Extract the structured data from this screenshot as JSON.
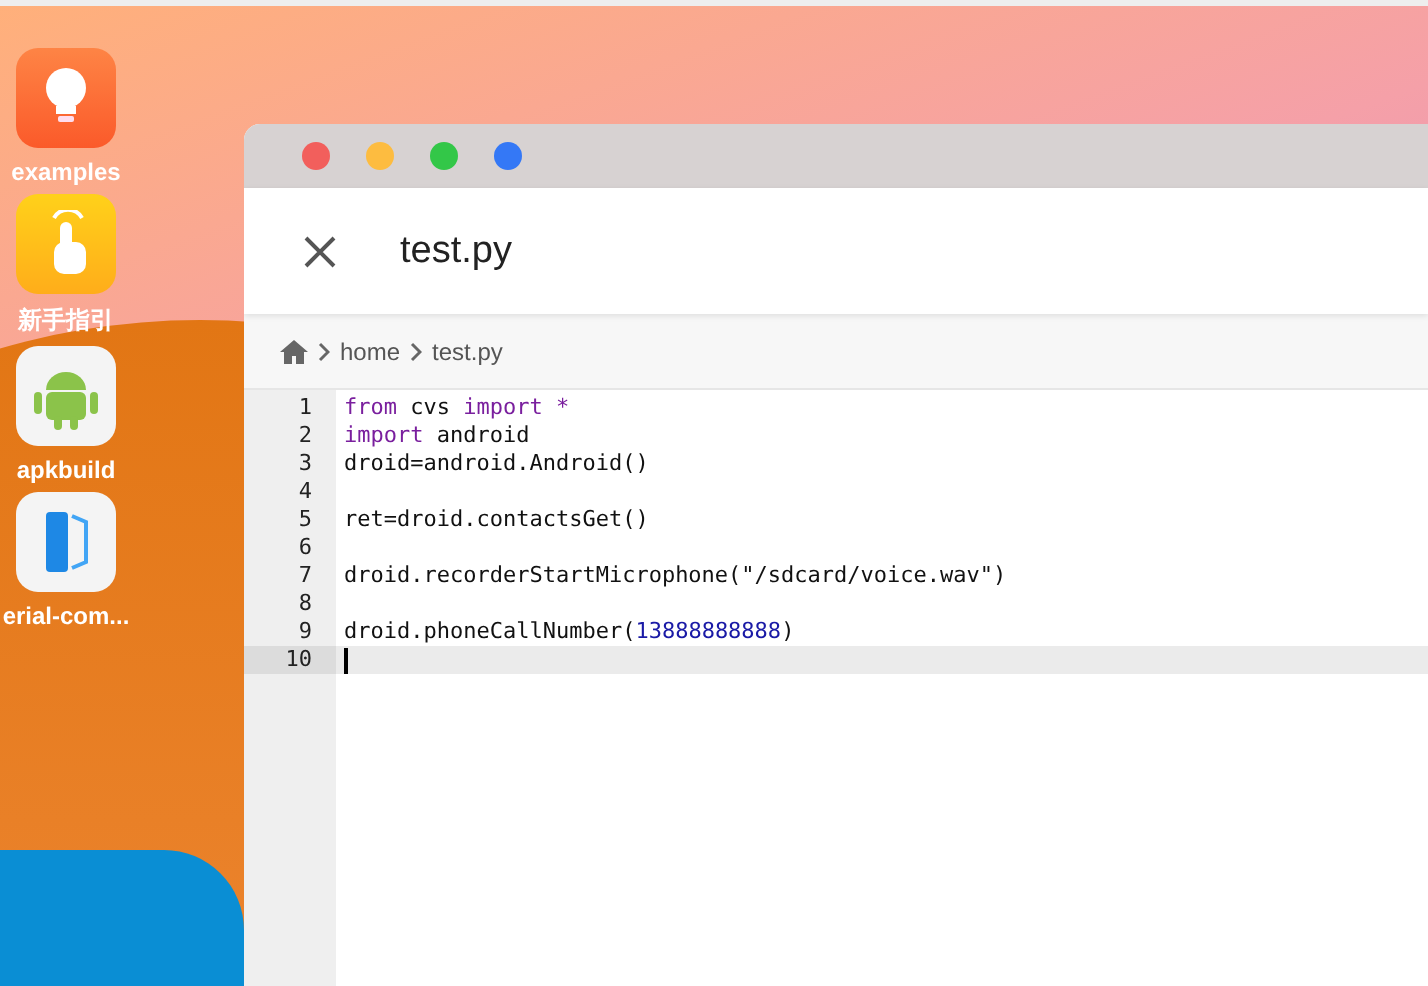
{
  "desktop_icons": [
    {
      "label": "examples",
      "kind": "bulb"
    },
    {
      "label": "新手指引",
      "kind": "hand"
    },
    {
      "label": "apkbuild",
      "kind": "android"
    },
    {
      "label": "erial-com...",
      "kind": "device"
    }
  ],
  "window": {
    "title": "test.py",
    "breadcrumb": [
      "home",
      "test.py"
    ]
  },
  "editor": {
    "lines": [
      {
        "number": "1",
        "selected": false,
        "tokens": [
          {
            "kind": "keyword",
            "text": "from"
          },
          {
            "kind": "plain",
            "text": " cvs "
          },
          {
            "kind": "keyword",
            "text": "import *"
          }
        ]
      },
      {
        "number": "2",
        "selected": false,
        "tokens": [
          {
            "kind": "keyword",
            "text": "import"
          },
          {
            "kind": "plain",
            "text": " android"
          }
        ]
      },
      {
        "number": "3",
        "selected": false,
        "tokens": [
          {
            "kind": "plain",
            "text": "droid=android.Android()"
          }
        ]
      },
      {
        "number": "4",
        "selected": false
      },
      {
        "number": "5",
        "selected": false,
        "tokens": [
          {
            "kind": "plain",
            "text": "ret=droid.contactsGet()"
          }
        ]
      },
      {
        "number": "6",
        "selected": false
      },
      {
        "number": "7",
        "selected": false,
        "tokens": [
          {
            "kind": "plain",
            "text": "droid.recorderStartMicrophone(\"/sdcard/voice.wav\")"
          }
        ]
      },
      {
        "number": "8",
        "selected": false
      },
      {
        "number": "9",
        "selected": false,
        "tokens": [
          {
            "kind": "plain",
            "text": "droid.phoneCallNumber("
          },
          {
            "kind": "number",
            "text": "13888888888"
          },
          {
            "kind": "plain",
            "text": ")"
          }
        ]
      },
      {
        "number": "10",
        "selected": true
      }
    ]
  }
}
